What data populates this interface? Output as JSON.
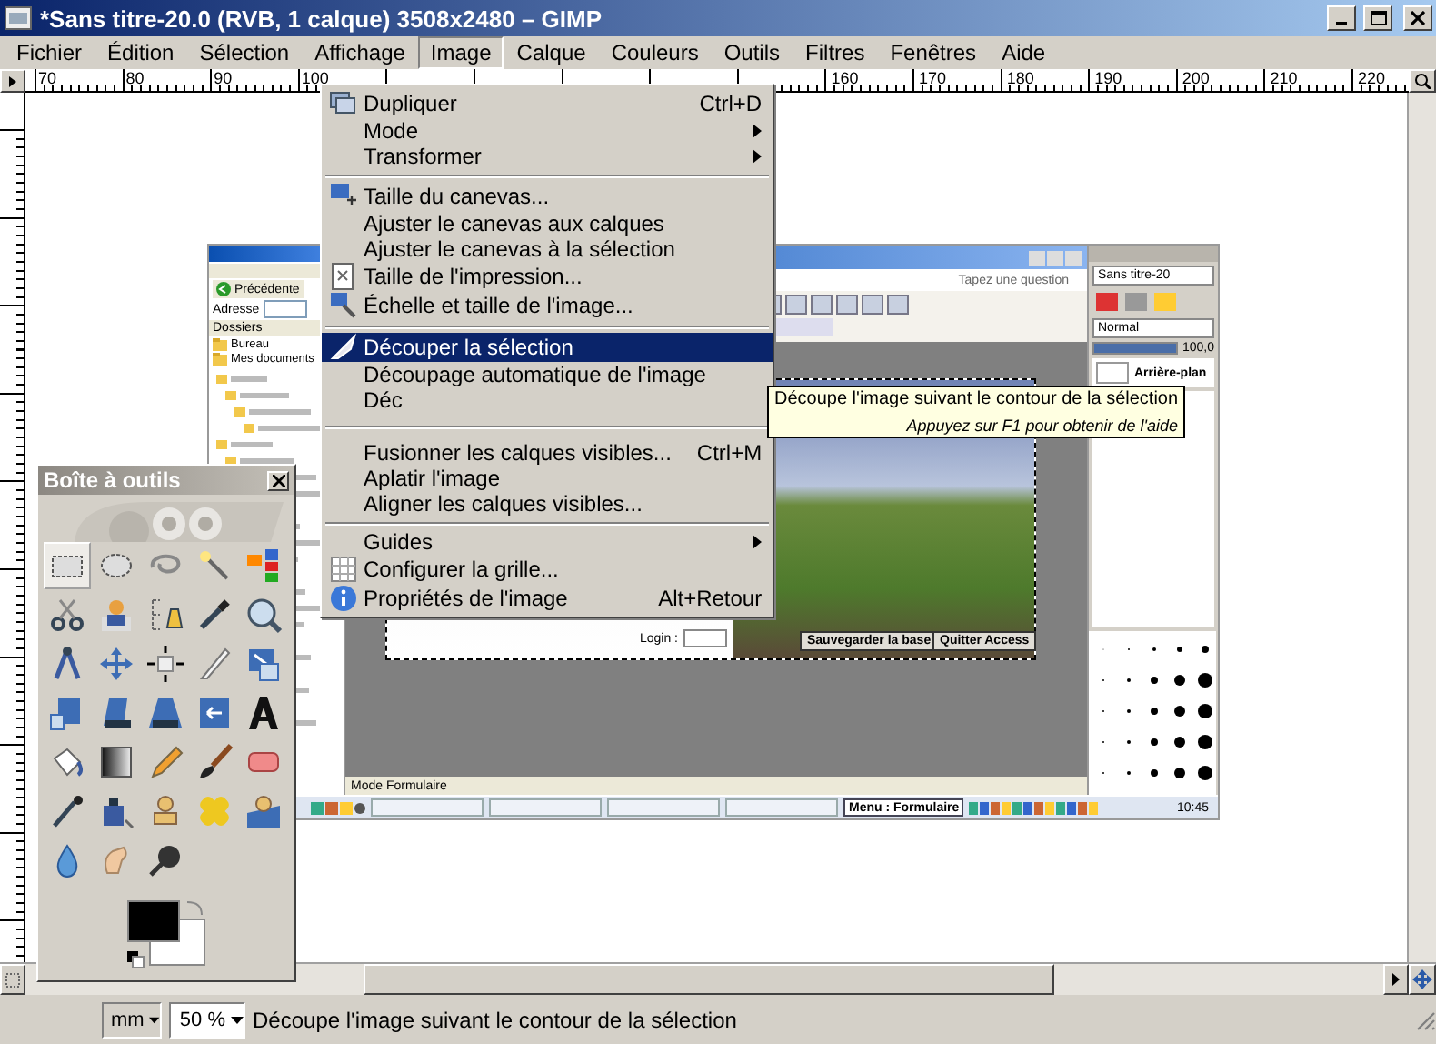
{
  "window": {
    "title": "*Sans titre-20.0 (RVB, 1 calque) 3508x2480 – GIMP"
  },
  "menubar": [
    {
      "label": "Fichier",
      "selected": false
    },
    {
      "label": "Édition",
      "selected": false
    },
    {
      "label": "Sélection",
      "selected": false
    },
    {
      "label": "Affichage",
      "selected": false
    },
    {
      "label": "Image",
      "selected": true
    },
    {
      "label": "Calque",
      "selected": false
    },
    {
      "label": "Couleurs",
      "selected": false
    },
    {
      "label": "Outils",
      "selected": false
    },
    {
      "label": "Filtres",
      "selected": false
    },
    {
      "label": "Fenêtres",
      "selected": false
    },
    {
      "label": "Aide",
      "selected": false
    }
  ],
  "ruler": {
    "left_labels": [
      "70",
      "80",
      "90",
      "100"
    ],
    "right_labels": [
      "160",
      "170",
      "180",
      "190",
      "200",
      "210",
      "220"
    ]
  },
  "image_menu": {
    "items": [
      {
        "kind": "item",
        "label": "Dupliquer",
        "shortcut": "Ctrl+D",
        "submenu": false,
        "selected": false
      },
      {
        "kind": "item",
        "label": "Mode",
        "submenu": true,
        "selected": false
      },
      {
        "kind": "item",
        "label": "Transformer",
        "submenu": true,
        "selected": false
      },
      {
        "kind": "separator"
      },
      {
        "kind": "item",
        "label": "Taille du canevas...",
        "submenu": false,
        "selected": false
      },
      {
        "kind": "item",
        "label": "Ajuster le canevas aux calques",
        "submenu": false,
        "selected": false
      },
      {
        "kind": "item",
        "label": "Ajuster le canevas à la sélection",
        "submenu": false,
        "selected": false
      },
      {
        "kind": "item",
        "label": "Taille de l'impression...",
        "submenu": false,
        "selected": false
      },
      {
        "kind": "item",
        "label": "Échelle et taille de l'image...",
        "submenu": false,
        "selected": false
      },
      {
        "kind": "separator"
      },
      {
        "kind": "item",
        "label": "Découper la sélection",
        "submenu": false,
        "selected": true
      },
      {
        "kind": "item",
        "label": "Découpage automatique de l'image",
        "submenu": false,
        "selected": false
      },
      {
        "kind": "item",
        "label": "Déc",
        "submenu": false,
        "selected": false
      },
      {
        "kind": "separator"
      },
      {
        "kind": "item",
        "label": "Fusionner les calques visibles...",
        "shortcut": "Ctrl+M",
        "submenu": false,
        "selected": false
      },
      {
        "kind": "item",
        "label": "Aplatir l'image",
        "submenu": false,
        "selected": false
      },
      {
        "kind": "item",
        "label": "Aligner les calques visibles...",
        "submenu": false,
        "selected": false
      },
      {
        "kind": "separator"
      },
      {
        "kind": "item",
        "label": "Guides",
        "submenu": true,
        "selected": false
      },
      {
        "kind": "item",
        "label": "Configurer la grille...",
        "submenu": false,
        "selected": false
      },
      {
        "kind": "item",
        "label": "Propriétés de l'image",
        "shortcut": "Alt+Retour",
        "submenu": false,
        "selected": false
      }
    ],
    "tooltip": {
      "text": "Découpe l'image suivant le contour de la sélection",
      "hint": "Appuyez sur F1 pour obtenir de l'aide"
    }
  },
  "canvas": {
    "embedded_screenshot": {
      "explorer": {
        "back_button": "Précédente",
        "address_label": "Adresse",
        "folders_header": "Dossiers",
        "tree": [
          {
            "label": "Bureau"
          },
          {
            "label": "Mes documents"
          }
        ]
      },
      "app": {
        "help_search": "Tapez une question",
        "form": {
          "login_label": "Login :",
          "buttons": [
            "Sauvegarder la base",
            "Quitter Access"
          ]
        },
        "status": "Mode Formulaire"
      },
      "dock": {
        "image": "Sans titre-20",
        "mode": "Normal",
        "opacity": {
          "reading": "100,0",
          "level": 1
        },
        "layer": "Arrière-plan"
      },
      "taskbar": {
        "buttons": [
          {
            "label": "Menu : Formulaire",
            "selected": true
          }
        ],
        "clock": "10:45"
      }
    }
  },
  "toolbox": {
    "title": "Boîte à outils",
    "tools": [
      {
        "selected": true
      },
      {
        "selected": false
      },
      {
        "selected": false
      },
      {
        "selected": false
      },
      {
        "selected": false
      },
      {
        "selected": false
      },
      {
        "selected": false
      },
      {
        "selected": false
      },
      {
        "selected": false
      },
      {
        "selected": false
      },
      {
        "selected": false
      },
      {
        "selected": false
      },
      {
        "selected": false
      },
      {
        "selected": false
      },
      {
        "selected": false
      },
      {
        "selected": false
      },
      {
        "selected": false
      },
      {
        "selected": false
      },
      {
        "selected": false
      },
      {
        "selected": false
      },
      {
        "selected": false
      },
      {
        "selected": false
      },
      {
        "selected": false
      },
      {
        "selected": false
      },
      {
        "selected": false
      },
      {
        "selected": false
      },
      {
        "selected": false
      },
      {
        "selected": false
      },
      {
        "selected": false
      },
      {
        "selected": false
      },
      {
        "selected": false
      },
      {
        "selected": false
      },
      {
        "selected": false
      }
    ]
  },
  "status_bar": {
    "unit": "mm",
    "zoom": "50 %",
    "message": "Découpe l'image suivant le contour de la sélection"
  }
}
